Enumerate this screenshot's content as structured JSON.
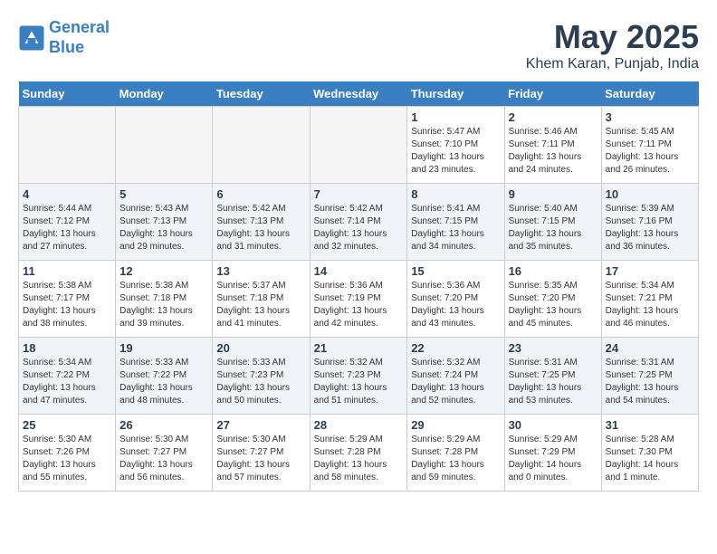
{
  "logo": {
    "line1": "General",
    "line2": "Blue"
  },
  "title": "May 2025",
  "location": "Khem Karan, Punjab, India",
  "weekdays": [
    "Sunday",
    "Monday",
    "Tuesday",
    "Wednesday",
    "Thursday",
    "Friday",
    "Saturday"
  ],
  "weeks": [
    [
      {
        "day": "",
        "empty": true
      },
      {
        "day": "",
        "empty": true
      },
      {
        "day": "",
        "empty": true
      },
      {
        "day": "",
        "empty": true
      },
      {
        "day": "1",
        "sunrise": "Sunrise: 5:47 AM",
        "sunset": "Sunset: 7:10 PM",
        "daylight": "Daylight: 13 hours and 23 minutes."
      },
      {
        "day": "2",
        "sunrise": "Sunrise: 5:46 AM",
        "sunset": "Sunset: 7:11 PM",
        "daylight": "Daylight: 13 hours and 24 minutes."
      },
      {
        "day": "3",
        "sunrise": "Sunrise: 5:45 AM",
        "sunset": "Sunset: 7:11 PM",
        "daylight": "Daylight: 13 hours and 26 minutes."
      }
    ],
    [
      {
        "day": "4",
        "sunrise": "Sunrise: 5:44 AM",
        "sunset": "Sunset: 7:12 PM",
        "daylight": "Daylight: 13 hours and 27 minutes."
      },
      {
        "day": "5",
        "sunrise": "Sunrise: 5:43 AM",
        "sunset": "Sunset: 7:13 PM",
        "daylight": "Daylight: 13 hours and 29 minutes."
      },
      {
        "day": "6",
        "sunrise": "Sunrise: 5:42 AM",
        "sunset": "Sunset: 7:13 PM",
        "daylight": "Daylight: 13 hours and 31 minutes."
      },
      {
        "day": "7",
        "sunrise": "Sunrise: 5:42 AM",
        "sunset": "Sunset: 7:14 PM",
        "daylight": "Daylight: 13 hours and 32 minutes."
      },
      {
        "day": "8",
        "sunrise": "Sunrise: 5:41 AM",
        "sunset": "Sunset: 7:15 PM",
        "daylight": "Daylight: 13 hours and 34 minutes."
      },
      {
        "day": "9",
        "sunrise": "Sunrise: 5:40 AM",
        "sunset": "Sunset: 7:15 PM",
        "daylight": "Daylight: 13 hours and 35 minutes."
      },
      {
        "day": "10",
        "sunrise": "Sunrise: 5:39 AM",
        "sunset": "Sunset: 7:16 PM",
        "daylight": "Daylight: 13 hours and 36 minutes."
      }
    ],
    [
      {
        "day": "11",
        "sunrise": "Sunrise: 5:38 AM",
        "sunset": "Sunset: 7:17 PM",
        "daylight": "Daylight: 13 hours and 38 minutes."
      },
      {
        "day": "12",
        "sunrise": "Sunrise: 5:38 AM",
        "sunset": "Sunset: 7:18 PM",
        "daylight": "Daylight: 13 hours and 39 minutes."
      },
      {
        "day": "13",
        "sunrise": "Sunrise: 5:37 AM",
        "sunset": "Sunset: 7:18 PM",
        "daylight": "Daylight: 13 hours and 41 minutes."
      },
      {
        "day": "14",
        "sunrise": "Sunrise: 5:36 AM",
        "sunset": "Sunset: 7:19 PM",
        "daylight": "Daylight: 13 hours and 42 minutes."
      },
      {
        "day": "15",
        "sunrise": "Sunrise: 5:36 AM",
        "sunset": "Sunset: 7:20 PM",
        "daylight": "Daylight: 13 hours and 43 minutes."
      },
      {
        "day": "16",
        "sunrise": "Sunrise: 5:35 AM",
        "sunset": "Sunset: 7:20 PM",
        "daylight": "Daylight: 13 hours and 45 minutes."
      },
      {
        "day": "17",
        "sunrise": "Sunrise: 5:34 AM",
        "sunset": "Sunset: 7:21 PM",
        "daylight": "Daylight: 13 hours and 46 minutes."
      }
    ],
    [
      {
        "day": "18",
        "sunrise": "Sunrise: 5:34 AM",
        "sunset": "Sunset: 7:22 PM",
        "daylight": "Daylight: 13 hours and 47 minutes."
      },
      {
        "day": "19",
        "sunrise": "Sunrise: 5:33 AM",
        "sunset": "Sunset: 7:22 PM",
        "daylight": "Daylight: 13 hours and 48 minutes."
      },
      {
        "day": "20",
        "sunrise": "Sunrise: 5:33 AM",
        "sunset": "Sunset: 7:23 PM",
        "daylight": "Daylight: 13 hours and 50 minutes."
      },
      {
        "day": "21",
        "sunrise": "Sunrise: 5:32 AM",
        "sunset": "Sunset: 7:23 PM",
        "daylight": "Daylight: 13 hours and 51 minutes."
      },
      {
        "day": "22",
        "sunrise": "Sunrise: 5:32 AM",
        "sunset": "Sunset: 7:24 PM",
        "daylight": "Daylight: 13 hours and 52 minutes."
      },
      {
        "day": "23",
        "sunrise": "Sunrise: 5:31 AM",
        "sunset": "Sunset: 7:25 PM",
        "daylight": "Daylight: 13 hours and 53 minutes."
      },
      {
        "day": "24",
        "sunrise": "Sunrise: 5:31 AM",
        "sunset": "Sunset: 7:25 PM",
        "daylight": "Daylight: 13 hours and 54 minutes."
      }
    ],
    [
      {
        "day": "25",
        "sunrise": "Sunrise: 5:30 AM",
        "sunset": "Sunset: 7:26 PM",
        "daylight": "Daylight: 13 hours and 55 minutes."
      },
      {
        "day": "26",
        "sunrise": "Sunrise: 5:30 AM",
        "sunset": "Sunset: 7:27 PM",
        "daylight": "Daylight: 13 hours and 56 minutes."
      },
      {
        "day": "27",
        "sunrise": "Sunrise: 5:30 AM",
        "sunset": "Sunset: 7:27 PM",
        "daylight": "Daylight: 13 hours and 57 minutes."
      },
      {
        "day": "28",
        "sunrise": "Sunrise: 5:29 AM",
        "sunset": "Sunset: 7:28 PM",
        "daylight": "Daylight: 13 hours and 58 minutes."
      },
      {
        "day": "29",
        "sunrise": "Sunrise: 5:29 AM",
        "sunset": "Sunset: 7:28 PM",
        "daylight": "Daylight: 13 hours and 59 minutes."
      },
      {
        "day": "30",
        "sunrise": "Sunrise: 5:29 AM",
        "sunset": "Sunset: 7:29 PM",
        "daylight": "Daylight: 14 hours and 0 minutes."
      },
      {
        "day": "31",
        "sunrise": "Sunrise: 5:28 AM",
        "sunset": "Sunset: 7:30 PM",
        "daylight": "Daylight: 14 hours and 1 minute."
      }
    ]
  ]
}
